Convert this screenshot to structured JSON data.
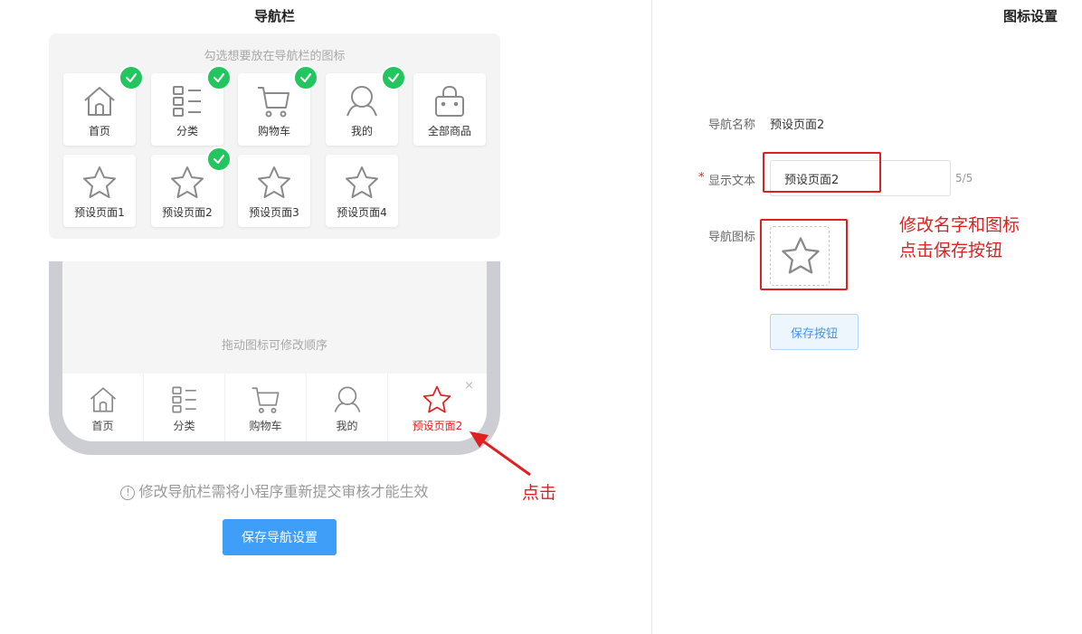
{
  "left_panel": {
    "title": "导航栏"
  },
  "right_panel": {
    "title": "图标设置"
  },
  "picker": {
    "hint": "勾选想要放在导航栏的图标",
    "tiles": [
      {
        "label": "首页",
        "icon": "home-icon",
        "checked": true
      },
      {
        "label": "分类",
        "icon": "category-list-icon",
        "checked": true
      },
      {
        "label": "购物车",
        "icon": "cart-icon",
        "checked": true
      },
      {
        "label": "我的",
        "icon": "user-icon",
        "checked": true
      },
      {
        "label": "全部商品",
        "icon": "bag-icon",
        "checked": false
      },
      {
        "label": "预设页面1",
        "icon": "star-icon",
        "checked": false
      },
      {
        "label": "预设页面2",
        "icon": "star-icon",
        "checked": true
      },
      {
        "label": "预设页面3",
        "icon": "star-icon",
        "checked": false
      },
      {
        "label": "预设页面4",
        "icon": "star-icon",
        "checked": false
      }
    ]
  },
  "preview": {
    "drag_hint": "拖动图标可修改顺序",
    "tabs": [
      {
        "label": "首页",
        "icon": "home-icon"
      },
      {
        "label": "分类",
        "icon": "category-list-icon"
      },
      {
        "label": "购物车",
        "icon": "cart-icon"
      },
      {
        "label": "我的",
        "icon": "user-icon"
      },
      {
        "label": "预设页面2",
        "icon": "star-icon",
        "active": true
      }
    ],
    "remove_glyph": "×"
  },
  "notice": {
    "icon_glyph": "!",
    "text": "修改导航栏需将小程序重新提交审核才能生效"
  },
  "save_nav_button": "保存导航设置",
  "form": {
    "name_label": "导航名称",
    "name_value": "预设页面2",
    "required_mark": "*",
    "text_label": "显示文本",
    "text_value": "预设页面2",
    "text_count": "5/5",
    "icon_label": "导航图标",
    "icon": "star-icon",
    "save_button": "保存按钮"
  },
  "annotations": {
    "right_line1": "修改名字和图标",
    "right_line2": "点击保存按钮",
    "click_label": "点击"
  },
  "colors": {
    "primary": "#3f9ef7",
    "check": "#22c55e",
    "annotation": "#e02020",
    "active_tab": "#e02020"
  }
}
